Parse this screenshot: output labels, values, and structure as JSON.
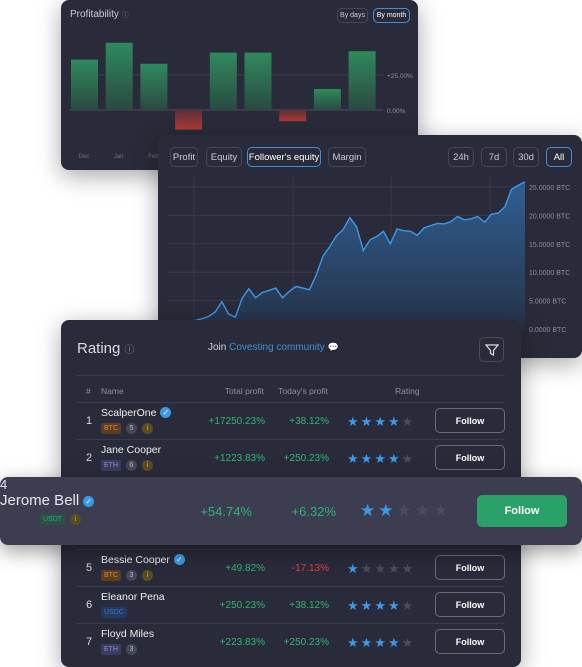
{
  "colors": {
    "panel": "#2a2b3a",
    "accent": "#3f8fd8",
    "positive": "#2fb56f",
    "negative": "#d9433f",
    "star_on": "#3b9ae8",
    "star_off": "#4a4c5c",
    "follow_active": "#2aa168"
  },
  "profitability": {
    "title": "Profitability",
    "info_icon": "info-icon",
    "buttons": [
      "By days",
      "By month"
    ],
    "active": "By month",
    "chart_data": {
      "type": "bar",
      "values": [
        36,
        48,
        33,
        -14,
        41,
        41,
        -8,
        15,
        42
      ],
      "categories": [
        "Dec",
        "Jan",
        "Feb"
      ],
      "yticks": [
        "+25.00%",
        "0.00%"
      ],
      "ylim": [
        -20,
        60
      ]
    }
  },
  "equity": {
    "tabs": [
      "Profit",
      "Equity",
      "Follower's equity",
      "Margin"
    ],
    "active_tab": "Follower's equity",
    "ranges": [
      "24h",
      "7d",
      "30d",
      "All"
    ],
    "active_range": "All",
    "chart_data": {
      "type": "area",
      "ylabel_unit": "BTC",
      "yticks": [
        "25.0000 BTC",
        "20.0000 BTC",
        "15.0000 BTC",
        "10.0000 BTC",
        "5.0000 BTC",
        "0.0000 BTC"
      ],
      "ylim": [
        0,
        25
      ],
      "values": [
        0.5,
        0.8,
        1,
        1.2,
        1.5,
        1.8,
        2.2,
        3,
        4.8,
        2.6,
        2.1,
        5.4,
        7.1,
        5.5,
        6.4,
        6.8,
        7.2,
        5.5,
        6.6,
        7.5,
        7.2,
        6.9,
        9.5,
        12.8,
        14.5,
        16.4,
        17.5,
        19.6,
        18,
        13.8,
        15.7,
        16.3,
        17.2,
        15,
        17.6,
        17.3,
        17.2,
        16.5,
        17.8,
        18.2,
        18.6,
        18.5,
        18.9,
        19.8,
        19.2,
        19.4,
        19.8,
        18.8,
        20.2,
        20.4,
        21.5,
        24.6,
        25.3,
        25.9
      ]
    }
  },
  "rating": {
    "title": "Rating",
    "join_text": "Join",
    "community_link": "Covesting community",
    "filter_icon": "filter-icon",
    "columns": [
      "#",
      "Name",
      "Total profit",
      "Today's profit",
      "Rating"
    ],
    "rows": [
      {
        "rank": "1",
        "name": "ScalperOne",
        "verified": true,
        "currency": "BTC",
        "count": "5",
        "info": true,
        "total": "+17250.23%",
        "today": "+38.12%",
        "stars": 4,
        "follow": "Follow"
      },
      {
        "rank": "2",
        "name": "Jane Cooper",
        "verified": false,
        "currency": "ETH",
        "count": "6",
        "info": true,
        "total": "+1223.83%",
        "today": "+250.23%",
        "stars": 4,
        "follow": "Follow"
      },
      {
        "rank": "4",
        "name": "Jerome Bell",
        "verified": true,
        "currency": "USDT",
        "count": "",
        "info": true,
        "total": "+54.74%",
        "today": "+6.32%",
        "stars": 2,
        "follow": "Follow"
      },
      {
        "rank": "5",
        "name": "Bessie Cooper",
        "verified": true,
        "currency": "BTC",
        "count": "3",
        "info": true,
        "total": "+49.82%",
        "today": "-17.13%",
        "stars": 1,
        "follow": "Follow"
      },
      {
        "rank": "6",
        "name": "Eleanor Pena",
        "verified": false,
        "currency": "USDC",
        "count": "",
        "info": false,
        "total": "+250.23%",
        "today": "+38.12%",
        "stars": 4,
        "follow": "Follow"
      },
      {
        "rank": "7",
        "name": "Floyd Miles",
        "verified": false,
        "currency": "ETH",
        "count": "3",
        "info": false,
        "total": "+223.83%",
        "today": "+250.23%",
        "stars": 4,
        "follow": "Follow"
      }
    ]
  }
}
